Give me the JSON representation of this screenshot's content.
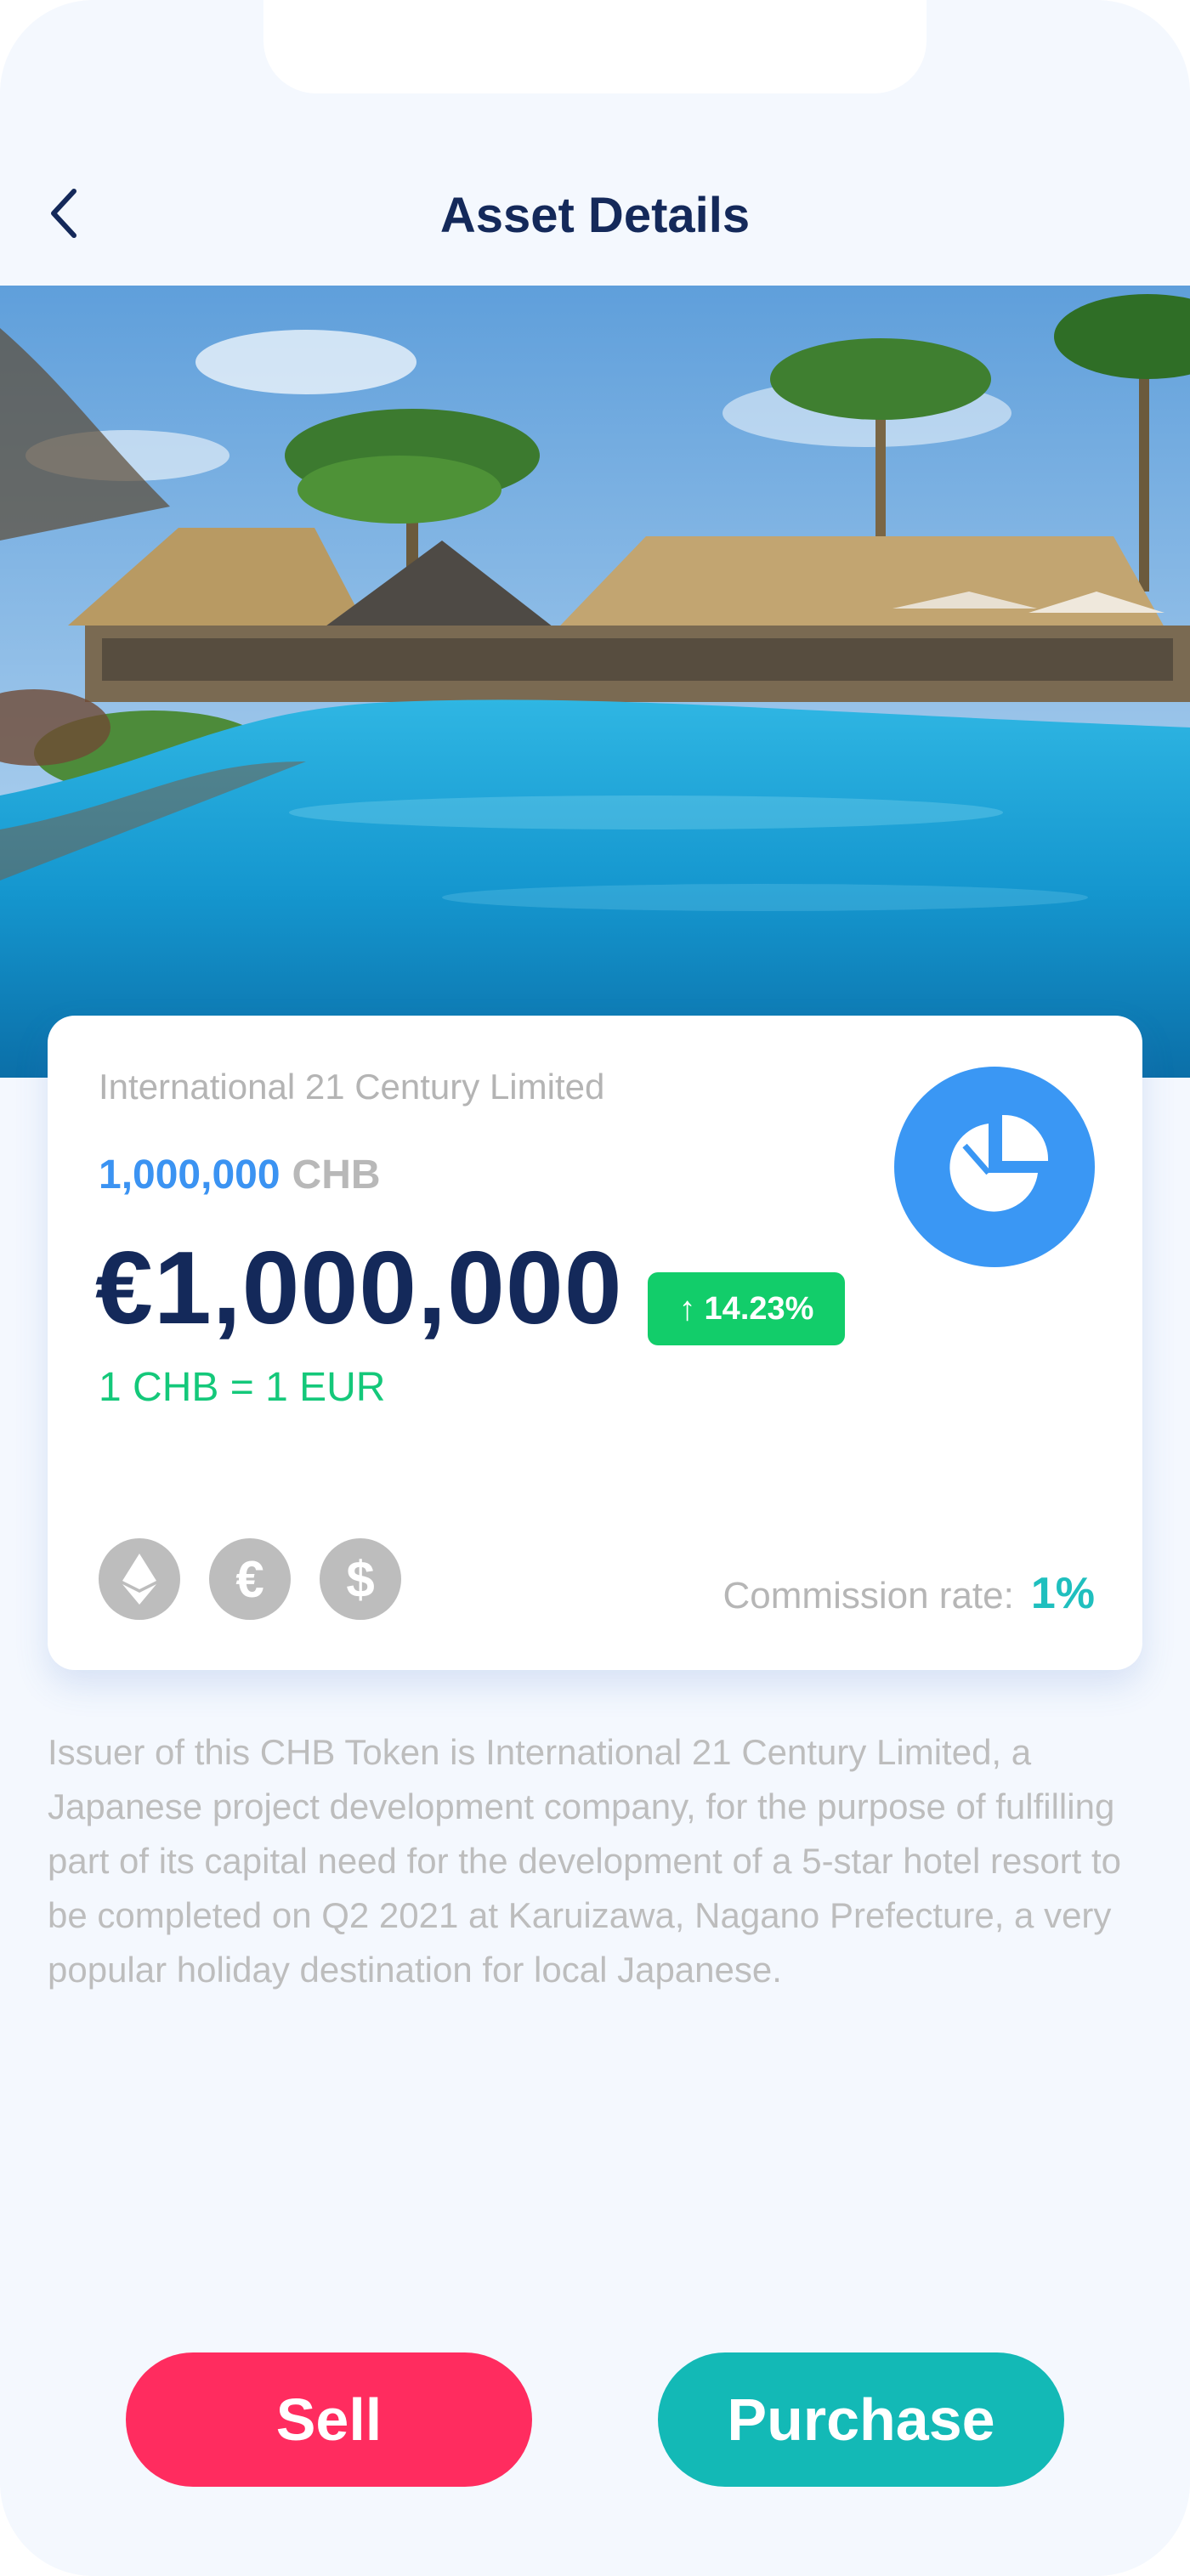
{
  "header": {
    "title": "Asset Details",
    "back_icon": "chevron-left-icon"
  },
  "hero": {
    "image_icon": "resort-pool-photo"
  },
  "asset_card": {
    "issuer_name": "International 21 Century Limited",
    "token_amount": "1,000,000",
    "token_symbol": "CHB",
    "price": "€1,000,000",
    "change": "14.23%",
    "change_direction": "up",
    "rate": "1 CHB = 1 EUR",
    "chart_icon": "pie-chart-icon",
    "currency_icons": [
      {
        "name": "ethereum-icon",
        "glyph": ""
      },
      {
        "name": "euro-icon",
        "glyph": "€"
      },
      {
        "name": "dollar-icon",
        "glyph": "$"
      }
    ],
    "commission_label": "Commission rate:",
    "commission_value": "1%"
  },
  "description": "Issuer of this CHB Token is International 21 Century Limited, a Japanese project development company, for the purpose of fulfilling part of its capital need for the development of a 5-star hotel resort to be completed on Q2 2021 at Karuizawa, Nagano Prefecture, a very popular holiday destination for local Japanese.",
  "actions": {
    "sell_label": "Sell",
    "purchase_label": "Purchase"
  },
  "colors": {
    "title": "#14295a",
    "accent_blue": "#3b93f2",
    "positive_green": "#12cd6a",
    "sell_red": "#ff2c5f",
    "purchase_teal": "#13b9b6",
    "commission_teal": "#1fbfbe"
  }
}
